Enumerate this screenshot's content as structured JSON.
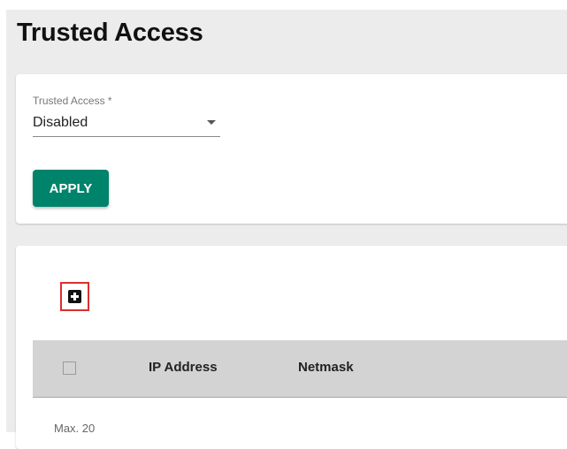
{
  "page": {
    "title": "Trusted Access"
  },
  "settings": {
    "field_label": "Trusted Access *",
    "selected_value": "Disabled",
    "apply_label": "APPLY"
  },
  "table": {
    "add_icon": "add-box-icon",
    "columns": [
      "IP Address",
      "Netmask"
    ],
    "footer_note": "Max. 20"
  },
  "colors": {
    "accent": "#00836b",
    "highlight_box": "#d9302e",
    "header_bg": "#d3d3d3",
    "page_bg": "#ececec"
  }
}
